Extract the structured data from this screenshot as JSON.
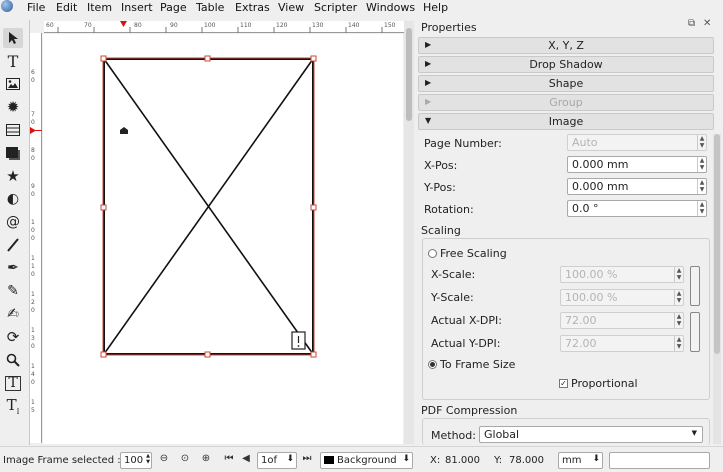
{
  "menu": [
    "File",
    "Edit",
    "Item",
    "Insert",
    "Page",
    "Table",
    "Extras",
    "View",
    "Scripter",
    "Windows",
    "Help"
  ],
  "tools": [
    "select-icon",
    "text-icon",
    "image-icon",
    "render-icon",
    "table-icon",
    "shape-icon",
    "polygon-icon",
    "arc-icon",
    "spiral-icon",
    "line-icon",
    "bezier-icon",
    "freehand-icon",
    "calligraphy-icon",
    "rotate-icon",
    "zoom-icon",
    "edit-text-icon",
    "link-text-icon"
  ],
  "ruler": {
    "h_ticks": [
      "60",
      "70",
      "80",
      "90",
      "100",
      "110",
      "120",
      "130",
      "140",
      "150",
      "160",
      "170",
      "180"
    ],
    "v_ticks": [
      "6",
      "0",
      "7",
      "0",
      "8",
      "0",
      "9",
      "0",
      "1",
      "0",
      "0",
      "1",
      "1",
      "0",
      "1",
      "2",
      "0",
      "1",
      "3",
      "0",
      "1",
      "4",
      "0",
      "1",
      "5"
    ]
  },
  "properties": {
    "title": "Properties",
    "sections": [
      {
        "label": "X, Y, Z",
        "state": "collapsed",
        "enabled": true
      },
      {
        "label": "Drop Shadow",
        "state": "collapsed",
        "enabled": true
      },
      {
        "label": "Shape",
        "state": "collapsed",
        "enabled": true
      },
      {
        "label": "Group",
        "state": "collapsed",
        "enabled": false
      },
      {
        "label": "Image",
        "state": "expanded",
        "enabled": true
      }
    ],
    "image": {
      "page_number_label": "Page Number:",
      "page_number_value": "Auto",
      "xpos_label": "X-Pos:",
      "xpos_value": "0.000 mm",
      "ypos_label": "Y-Pos:",
      "ypos_value": "0.000 mm",
      "rotation_label": "Rotation:",
      "rotation_value": "0.0 °",
      "scaling_label": "Scaling",
      "free_scaling_label": "Free Scaling",
      "xscale_label": "X-Scale:",
      "xscale_value": "100.00 %",
      "yscale_label": "Y-Scale:",
      "yscale_value": "100.00 %",
      "xdpi_label": "Actual X-DPI:",
      "xdpi_value": "72.00",
      "ydpi_label": "Actual Y-DPI:",
      "ydpi_value": "72.00",
      "to_frame_label": "To Frame Size",
      "proportional_label": "Proportional",
      "pdf_label": "PDF Compression",
      "method_label": "Method:",
      "method_value": "Global"
    }
  },
  "status": {
    "message": "Image Frame selected :",
    "zoom": "100",
    "page_current": "1",
    "page_of": "of",
    "layer": "Background",
    "x_label": "X:",
    "x_value": "81.000",
    "y_label": "Y:",
    "y_value": "78.000",
    "unit": "mm"
  },
  "colors": {
    "accent": "#cc3322",
    "layer_swatch": "#000000"
  }
}
